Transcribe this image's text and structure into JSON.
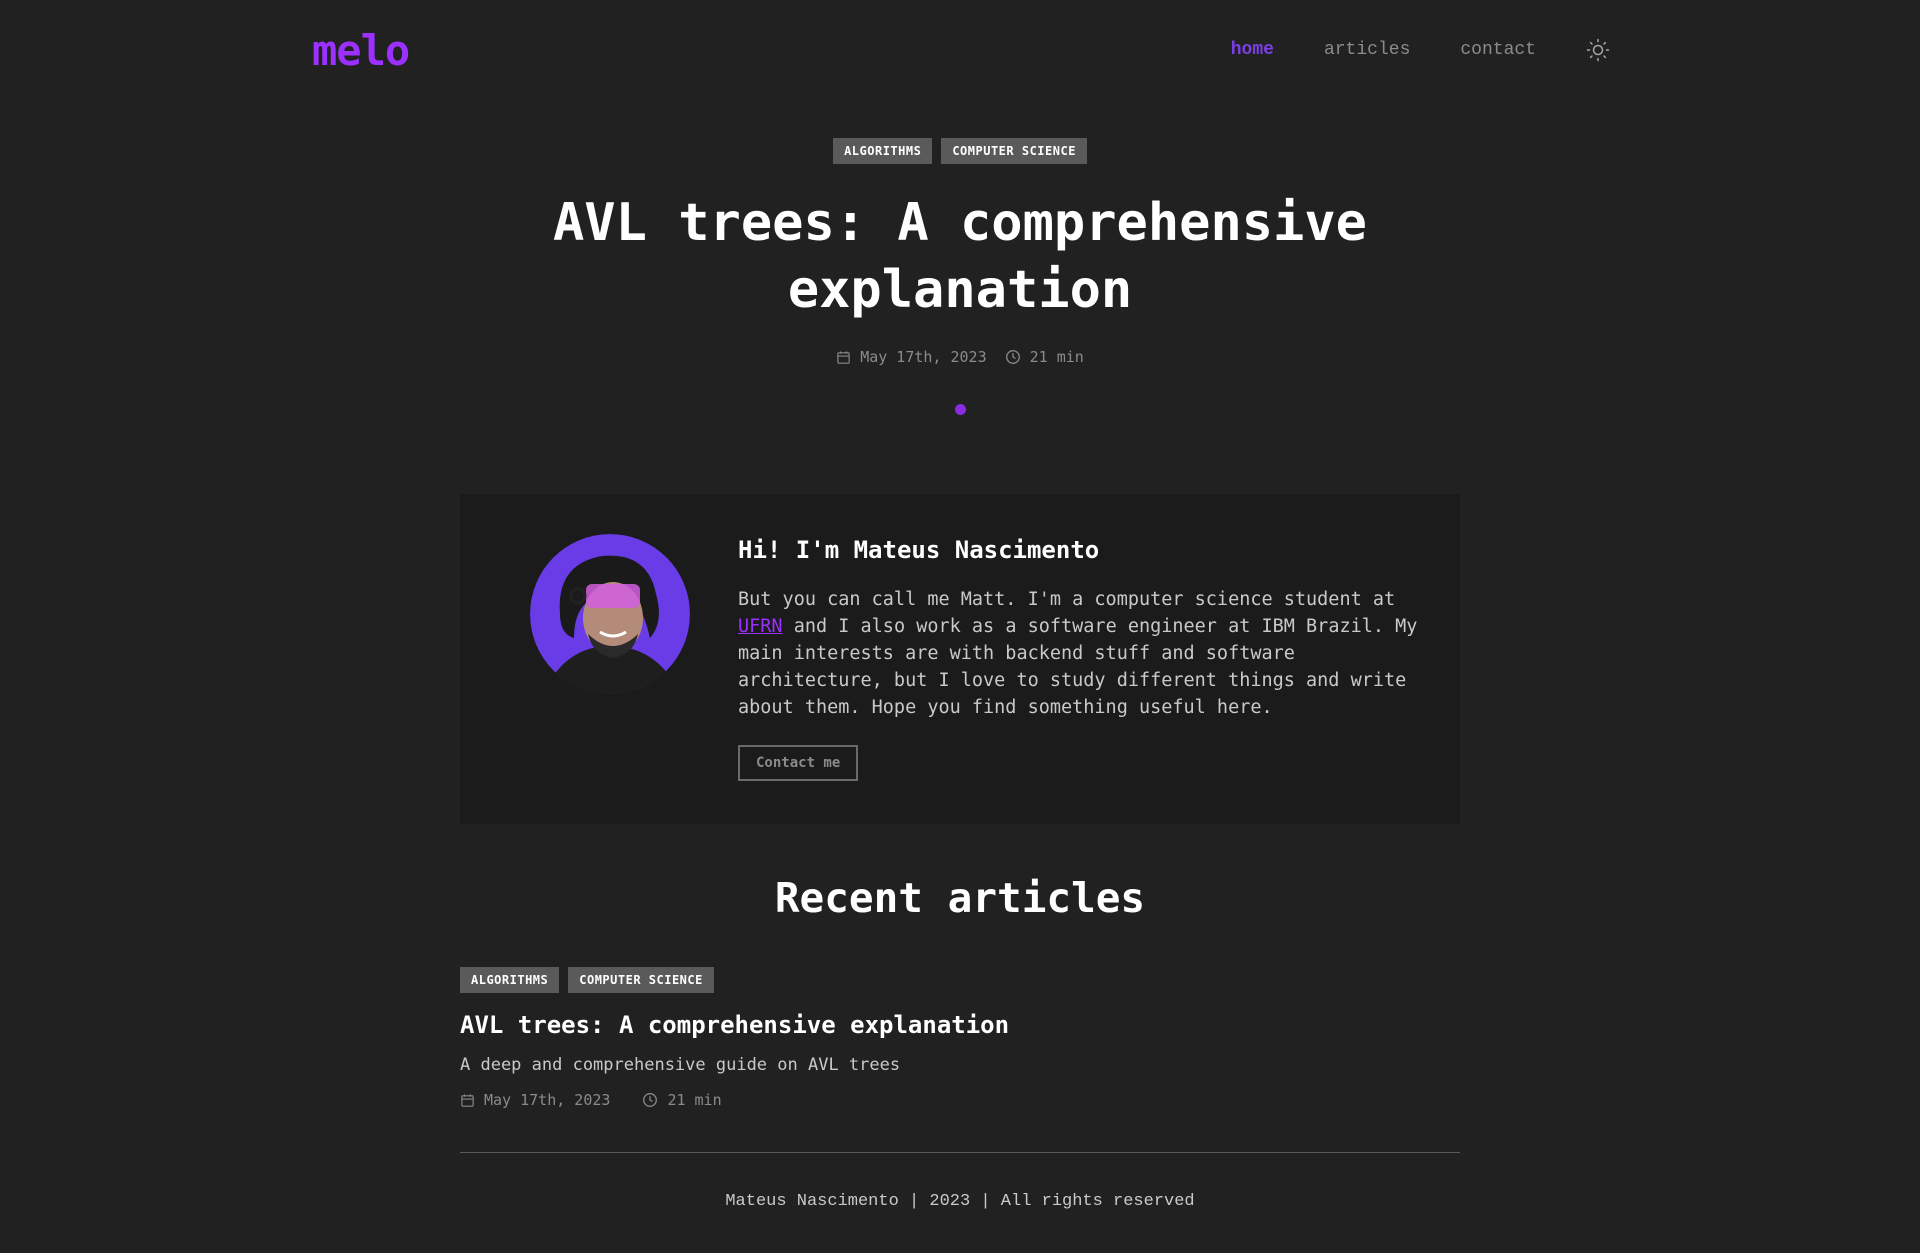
{
  "header": {
    "logo": "melo",
    "nav": [
      {
        "label": "home",
        "active": true
      },
      {
        "label": "articles",
        "active": false
      },
      {
        "label": "contact",
        "active": false
      }
    ],
    "theme_icon": "sun-icon"
  },
  "hero": {
    "tags": [
      "ALGORITHMS",
      "COMPUTER SCIENCE"
    ],
    "title": "AVL trees: A comprehensive explanation",
    "date": "May 17th, 2023",
    "read_time": "21 min"
  },
  "about": {
    "title": "Hi! I'm Mateus Nascimento",
    "text_before_link": "But you can call me Matt. I'm a computer science student at ",
    "link": "UFRN",
    "text_after_link": " and I also work as a software engineer at IBM Brazil. My main interests are with backend stuff and software architecture, but I love to study different things and write about them. Hope you find something useful here.",
    "button": "Contact me"
  },
  "recent": {
    "title": "Recent articles",
    "articles": [
      {
        "tags": [
          "ALGORITHMS",
          "COMPUTER SCIENCE"
        ],
        "title": "AVL trees: A comprehensive explanation",
        "description": "A deep and comprehensive guide on AVL trees",
        "date": "May 17th, 2023",
        "read_time": "21 min"
      }
    ]
  },
  "footer": {
    "text": "Mateus Nascimento | 2023 | All rights reserved"
  },
  "colors": {
    "background": "#212121",
    "card": "#1b1b1b",
    "accent": "#9b30ff",
    "nav_active": "#7b3fe4",
    "tag_bg": "#5a5a5a"
  }
}
